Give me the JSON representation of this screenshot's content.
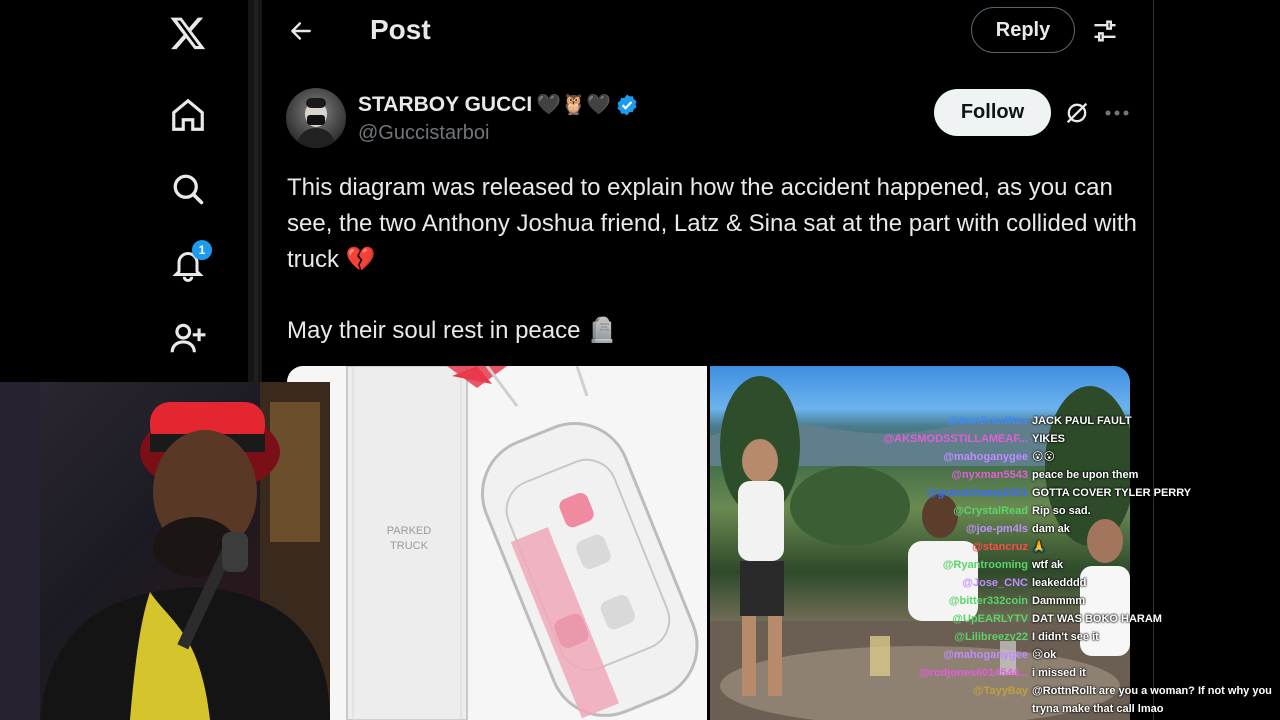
{
  "nav": {
    "items": [
      {
        "name": "x-logo-icon"
      },
      {
        "name": "home-icon"
      },
      {
        "name": "search-icon"
      },
      {
        "name": "notifications-icon"
      },
      {
        "name": "follow-user-icon"
      }
    ],
    "notification_count": "1"
  },
  "header": {
    "title": "Post",
    "reply_label": "Reply"
  },
  "author": {
    "name": "STARBOY GUCCI",
    "name_emojis": "🖤🦉🖤",
    "handle": "@Guccistarboi",
    "verified": true,
    "follow_label": "Follow"
  },
  "post": {
    "text": "This diagram was released to explain how the accident happened, as you can see, the two Anthony Joshua friend, Latz & Sina sat at the part with collided with truck 💔",
    "text2": "May their soul rest in peace 🪦"
  },
  "media": {
    "diagram_label": "PARKED\nTRUCK"
  },
  "chat": [
    {
      "user": "@SunDriedRes",
      "msg": "JACK PAUL FAULT",
      "color": "#3b8cff"
    },
    {
      "user": "@AKSMODSSTILLAMEAF...",
      "msg": "YIKES",
      "color": "#e060d6"
    },
    {
      "user": "@mahoganygee",
      "msg": "😮😮",
      "color": "#c08cff"
    },
    {
      "user": "@nyxman5543",
      "msg": "peace be upon them",
      "color": "#e060d6"
    },
    {
      "user": "@grandchamp2021",
      "msg": "GOTTA COVER TYLER PERRY",
      "color": "#3b6bff"
    },
    {
      "user": "@CrystalRead",
      "msg": "Rip so sad.",
      "color": "#5bd36a"
    },
    {
      "user": "@joe-pm4ls",
      "msg": "dam ak",
      "color": "#c08cff"
    },
    {
      "user": "@stancruz",
      "msg": "🙏",
      "color": "#ff4a4a"
    },
    {
      "user": "@Ryantrooming",
      "msg": "wtf ak",
      "color": "#5bd36a"
    },
    {
      "user": "@Jose_CNC",
      "msg": "leakedddd",
      "color": "#c08cff"
    },
    {
      "user": "@bitter332coin",
      "msg": "Dammmm",
      "color": "#5bd36a"
    },
    {
      "user": "@UpEARLYTV",
      "msg": "DAT WAS BOKO HARAM",
      "color": "#5bd36a"
    },
    {
      "user": "@Lilibreezy22",
      "msg": "I didn't see it",
      "color": "#5bd36a"
    },
    {
      "user": "@mahoganygee",
      "msg": "😢ok",
      "color": "#c08cff"
    },
    {
      "user": "@rodjones6014544...",
      "msg": "i missed it",
      "color": "#e060d6"
    },
    {
      "user": "@TayyBay",
      "msg": "@RottnRollt are you a woman? If not why you tryna make that call lmao",
      "color": "#c0a040"
    }
  ]
}
